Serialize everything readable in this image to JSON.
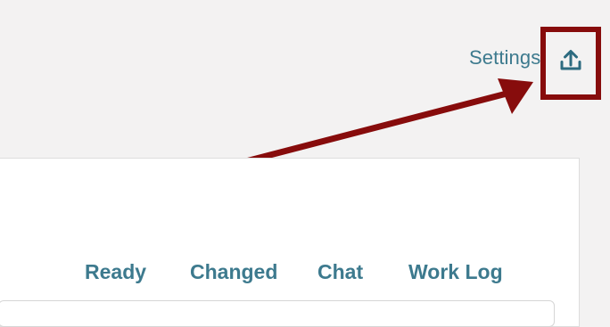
{
  "header": {
    "settings_label": "Settings",
    "upload_icon": "upload-icon"
  },
  "tabs": [
    {
      "label": "Ready"
    },
    {
      "label": "Changed"
    },
    {
      "label": "Chat"
    },
    {
      "label": "Work Log"
    }
  ],
  "annotation": {
    "color": "#870c0c"
  },
  "colors": {
    "accent": "#3d7a8e",
    "background": "#f3f2f2",
    "panel": "#ffffff"
  }
}
